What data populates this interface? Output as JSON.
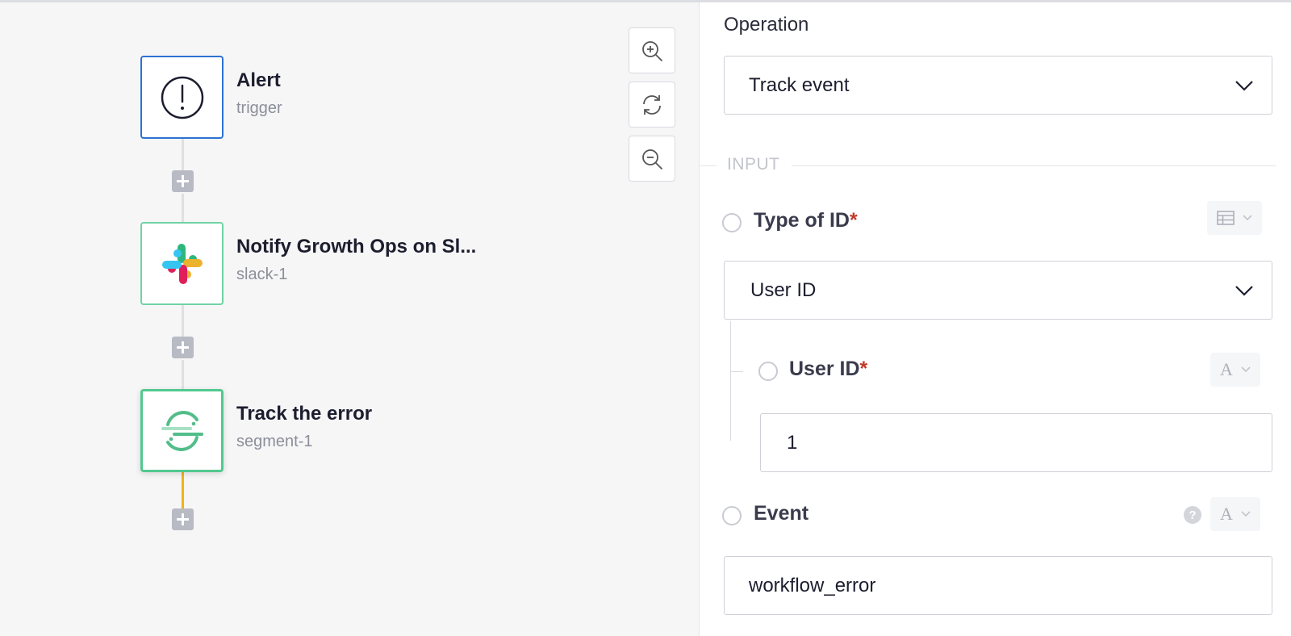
{
  "workflow": {
    "nodes": [
      {
        "title": "Alert",
        "subtitle": "trigger",
        "icon": "alert-icon"
      },
      {
        "title": "Notify Growth Ops on Sl...",
        "subtitle": "slack-1",
        "icon": "slack-icon"
      },
      {
        "title": "Track the error",
        "subtitle": "segment-1",
        "icon": "segment-icon"
      }
    ],
    "zoom_controls": [
      "zoom-in-icon",
      "refresh-icon",
      "zoom-out-icon"
    ]
  },
  "panel": {
    "operation_label": "Operation",
    "operation_value": "Track event",
    "section_title": "INPUT",
    "type_of_id": {
      "label": "Type of ID",
      "required_mark": "*",
      "value": "User ID",
      "toggle_icon": "table-icon"
    },
    "user_id": {
      "label": "User ID",
      "required_mark": "*",
      "value": "1",
      "toggle_icon": "text-type-icon"
    },
    "event": {
      "label": "Event",
      "value": "workflow_error",
      "toggle_icon": "text-type-icon",
      "help_icon": "help-icon"
    }
  },
  "colors": {
    "alert_border": "#2d72d2",
    "slack_border": "#6fd3a4",
    "segment_border": "#52c98f",
    "active_connector": "#f2b11e",
    "required": "#c0392b"
  }
}
